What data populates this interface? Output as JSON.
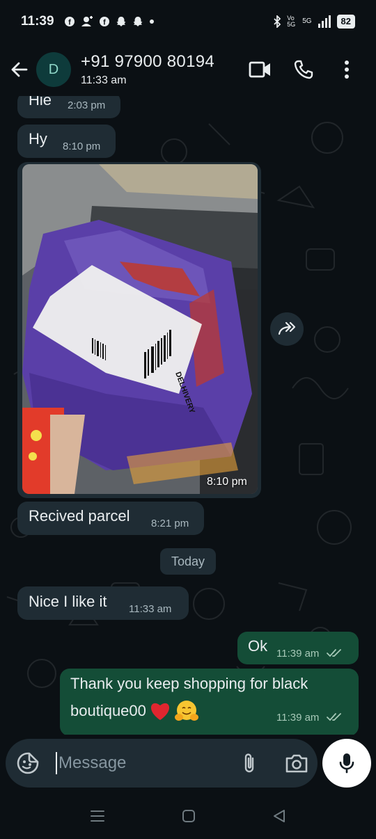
{
  "status_bar": {
    "time": "11:39",
    "network": "5G",
    "volte": "Vo 5G",
    "battery": "82"
  },
  "header": {
    "avatar_letter": "D",
    "contact_name": "+91 97900 80194",
    "last_seen": "11:33 am"
  },
  "messages": [
    {
      "direction": "in",
      "text": "Hie",
      "time": "2:03 pm"
    },
    {
      "direction": "in",
      "text": "Hy",
      "time": "8:10 pm"
    },
    {
      "direction": "in",
      "type": "image",
      "time": "8:10 pm",
      "image_label": "DELHIVERY"
    },
    {
      "direction": "in",
      "text": "Recived parcel",
      "time": "8:21 pm"
    },
    {
      "direction": "in",
      "text": "Nice I like it",
      "time": "11:33 am"
    },
    {
      "direction": "out",
      "text": "Ok",
      "time": "11:39 am"
    },
    {
      "direction": "out",
      "text_line1": "Thank you keep shopping for black",
      "text_line2": "boutique00",
      "time": "11:39 am"
    }
  ],
  "day_separator": "Today",
  "composer": {
    "placeholder": "Message"
  },
  "colors": {
    "background": "#0b1014",
    "incoming_bubble": "#1f2c34",
    "outgoing_bubble": "#144d37",
    "tick_read": "#a7c9b8"
  }
}
